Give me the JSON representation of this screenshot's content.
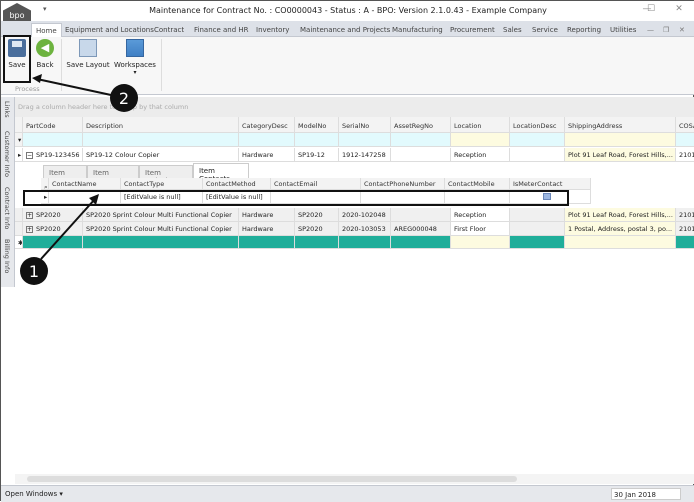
{
  "window": {
    "title": "Maintenance for Contract No. : CO0000043 - Status : A - BPO: Version 2.1.0.43 - Example Company",
    "logo_text": "bpo",
    "controls": [
      "minimize",
      "maximize",
      "close"
    ]
  },
  "menu_tabs": [
    "Home",
    "Equipment and Locations",
    "Contract",
    "Finance and HR",
    "Inventory",
    "Maintenance and Projects",
    "Manufacturing",
    "Procurement",
    "Sales",
    "Service",
    "Reporting",
    "Utilities"
  ],
  "ribbon": {
    "save": "Save",
    "back": "Back",
    "save_layout": "Save Layout",
    "workspaces": "Workspaces",
    "group_process": "Process"
  },
  "side_tabs": [
    "Links",
    "Customer Info",
    "Contract Info",
    "Billing Info"
  ],
  "group_panel": "Drag a column header here to group by that column",
  "grid": {
    "columns": [
      "PartCode",
      "Description",
      "CategoryDesc",
      "ModelNo",
      "SerialNo",
      "AssetRegNo",
      "Location",
      "LocationDesc",
      "ShippingAddress",
      "COSA"
    ],
    "rows": [
      [
        "SP19-123456",
        "SP19-12 Colour Copier",
        "Hardware",
        "SP19-12",
        "1912-147258",
        "",
        "Reception",
        "",
        "Plot 91 Leaf Road, Forest Hills,...",
        "2101"
      ],
      [
        "SP2020",
        "SP2020 Sprint Colour Multi Functional Copier",
        "Hardware",
        "SP2020",
        "2020-102048",
        "",
        "Reception",
        "",
        "Plot 91 Leaf Road, Forest Hills,...",
        "2101"
      ],
      [
        "SP2020",
        "SP2020 Sprint Colour Multi Functional Copier",
        "Hardware",
        "SP2020",
        "2020-103053",
        "AREG000048",
        "First Floor",
        "",
        "1 Postal, Address, postal 3, po...",
        "2101"
      ]
    ],
    "detail": {
      "tabs": [
        "Item Fees",
        "Item Meters",
        "Item Inclusions",
        "Item Contacts"
      ],
      "active_tab": "Item Contacts",
      "columns": [
        "ContactName",
        "ContactType",
        "ContactMethod",
        "ContactEmail",
        "ContactPhoneNumber",
        "ContactMobile",
        "IsMeterContact"
      ],
      "row": [
        "",
        "[EditValue is null]",
        "[EditValue is null]",
        "",
        "",
        "",
        ""
      ]
    }
  },
  "status": {
    "open_windows": "Open Windows",
    "date": "30 Jan 2018"
  },
  "annotations": [
    "1",
    "2"
  ]
}
